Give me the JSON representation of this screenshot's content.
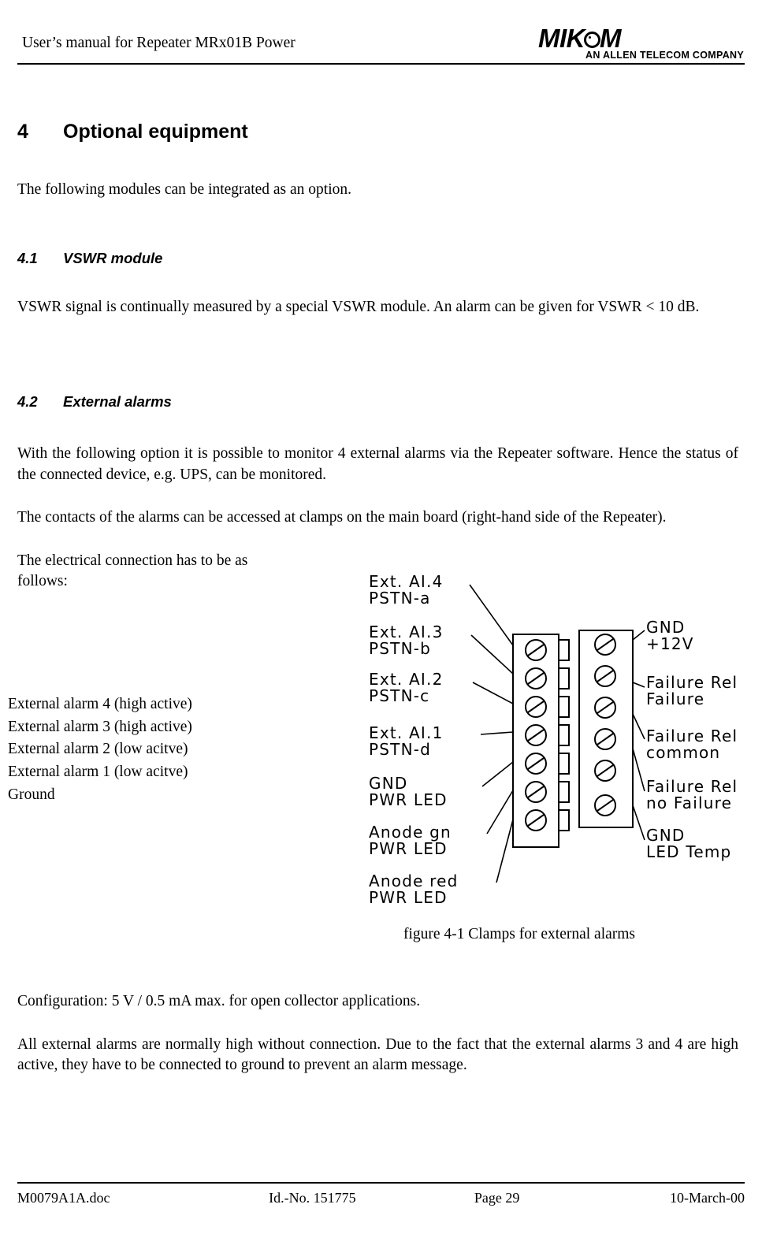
{
  "header": {
    "title": "User’s manual for Repeater MRx01B Power",
    "logo_text_part1": "MIK",
    "logo_text_part2": "M",
    "logo_subtitle": "AN ALLEN TELECOM COMPANY"
  },
  "sections": {
    "chapter_number": "4",
    "chapter_title": "Optional equipment",
    "intro": "The following modules can be integrated as an option.",
    "s41_number": "4.1",
    "s41_title": "VSWR module",
    "s41_body": "VSWR signal is continually measured by a special VSWR module. An alarm can be given for VSWR < 10 dB.",
    "s42_number": "4.2",
    "s42_title": "External alarms",
    "s42_p1": "With the following option it is possible to monitor 4 external alarms via the Repeater software. Hence the status of the connected device, e.g. UPS, can be monitored.",
    "s42_p2": "The contacts of the alarms can be accessed at clamps on the main board (right-hand side of the Repeater).",
    "s42_p3": "The electrical connection has to be as follows:",
    "s42_p4": "Configuration: 5 V / 0.5 mA max. for open collector applications.",
    "s42_p5": "All external alarms are normally high without connection. Due to the fact that the external alarms 3 and 4 are high active, they have to be connected to ground to prevent an alarm message."
  },
  "alarm_list": [
    "External alarm 4 (high active)",
    "External alarm 3 (high active)",
    "External alarm 2 (low acitve)",
    "External alarm 1 (low acitve)",
    "Ground"
  ],
  "figure": {
    "caption": "figure 4-1 Clamps for external alarms",
    "left_labels": [
      {
        "line1": "Ext. AI.4",
        "line2": "PSTN-a"
      },
      {
        "line1": "Ext. AI.3",
        "line2": "PSTN-b"
      },
      {
        "line1": "Ext. AI.2",
        "line2": "PSTN-c"
      },
      {
        "line1": "Ext. AI.1",
        "line2": "PSTN-d"
      },
      {
        "line1": "GND",
        "line2": "PWR LED"
      },
      {
        "line1": "Anode gn",
        "line2": "PWR LED"
      },
      {
        "line1": "Anode red",
        "line2": "PWR LED"
      }
    ],
    "right_labels": [
      {
        "line1": "GND",
        "line2": "+12V"
      },
      {
        "line1": "Failure Rel",
        "line2": "Failure"
      },
      {
        "line1": "Failure Rel",
        "line2": "common"
      },
      {
        "line1": "Failure Rel",
        "line2": "no Failure"
      },
      {
        "line1": "GND",
        "line2": "LED Temp"
      }
    ]
  },
  "footer": {
    "doc": "M0079A1A.doc",
    "id": "Id.-No. 151775",
    "page": "Page 29",
    "date": "10-March-00"
  }
}
